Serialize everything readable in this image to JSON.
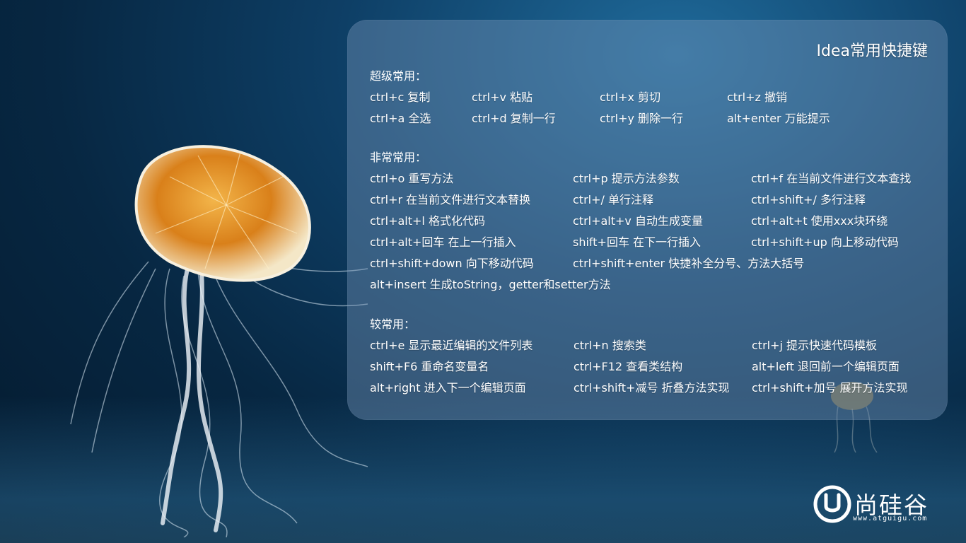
{
  "panel": {
    "title": "Idea常用快捷键",
    "sections": [
      {
        "header": "超级常用：",
        "rows": [
          [
            "ctrl+c 复制",
            "ctrl+v 粘贴",
            "ctrl+x 剪切",
            "ctrl+z 撤销"
          ],
          [
            "ctrl+a 全选",
            "ctrl+d 复制一行",
            "ctrl+y  删除一行",
            "alt+enter 万能提示"
          ]
        ]
      },
      {
        "header": "非常常用：",
        "rows": [
          [
            "ctrl+o 重写方法",
            "ctrl+p 提示方法参数",
            "ctrl+f 在当前文件进行文本查找"
          ],
          [
            "ctrl+r 在当前文件进行文本替换",
            "ctrl+/ 单行注释",
            "ctrl+shift+/ 多行注释"
          ],
          [
            "ctrl+alt+l 格式化代码",
            "ctrl+alt+v 自动生成变量",
            "ctrl+alt+t 使用xxx块环绕"
          ],
          [
            "ctrl+alt+回车 在上一行插入",
            "shift+回车 在下一行插入",
            "ctrl+shift+up 向上移动代码"
          ],
          [
            "ctrl+shift+down 向下移动代码",
            "ctrl+shift+enter 快捷补全分号、方法大括号"
          ],
          [
            "alt+insert 生成toString，getter和setter方法"
          ]
        ]
      },
      {
        "header": "较常用：",
        "rows": [
          [
            "ctrl+e 显示最近编辑的文件列表",
            "ctrl+n 搜索类",
            "ctrl+j 提示快速代码模板"
          ],
          [
            "shift+F6 重命名变量名",
            "ctrl+F12 查看类结构",
            "alt+left 退回前一个编辑页面"
          ],
          [
            "alt+right 进入下一个编辑页面",
            "ctrl+shift+减号 折叠方法实现",
            "ctrl+shift+加号 展开方法实现"
          ]
        ]
      }
    ]
  },
  "logo": {
    "name": "尚硅谷",
    "url": "www.atguigu.com",
    "icon": "u-logo-icon"
  },
  "colors": {
    "panel_bg": "#7896b9",
    "text": "#ffffff",
    "jelly_orange": "#e08a1e"
  }
}
